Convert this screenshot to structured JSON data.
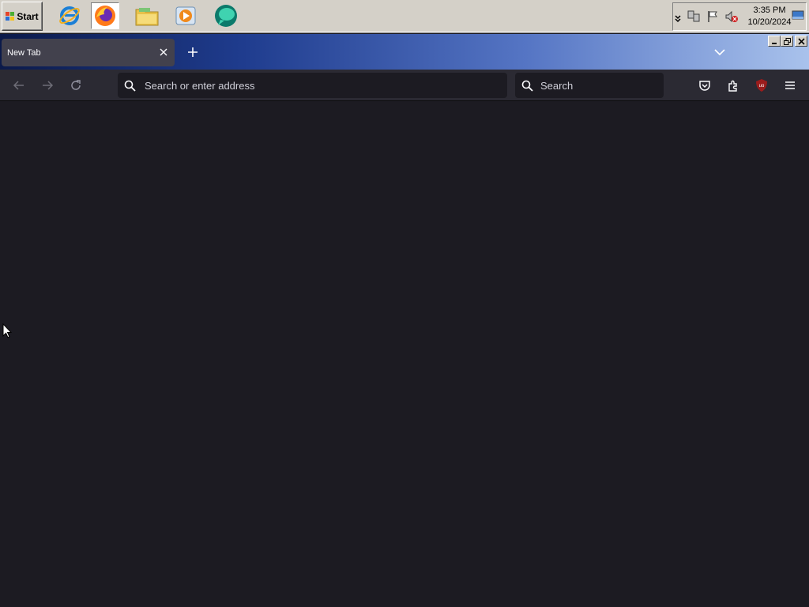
{
  "taskbar": {
    "start_label": "Start",
    "quick_launch": [
      {
        "name": "internet-explorer-icon"
      },
      {
        "name": "firefox-icon",
        "active": true
      },
      {
        "name": "file-explorer-icon"
      },
      {
        "name": "media-player-icon"
      },
      {
        "name": "chat-app-icon"
      }
    ],
    "tray": {
      "icons": [
        "chevron-down-icon",
        "network-icon",
        "flag-icon",
        "volume-muted-icon",
        "show-desktop-icon"
      ],
      "time": "3:35 PM",
      "date": "10/20/2024"
    }
  },
  "browser": {
    "tabs": [
      {
        "label": "New Tab",
        "active": true
      }
    ],
    "url": {
      "placeholder": "Search or enter address",
      "value": ""
    },
    "search": {
      "placeholder": "Search",
      "value": ""
    },
    "toolbar_icons": [
      "pocket-icon",
      "extensions-icon",
      "ublock-origin-icon",
      "menu-icon"
    ],
    "ublock_badge": "uo"
  },
  "colors": {
    "taskbar_bg": "#d4d0c8",
    "toolbar_bg": "#2b2a33",
    "content_bg": "#1c1b22",
    "tab_bg": "#42414d",
    "text": "#fbfbfe",
    "ublock_red": "#9b1c1c"
  }
}
